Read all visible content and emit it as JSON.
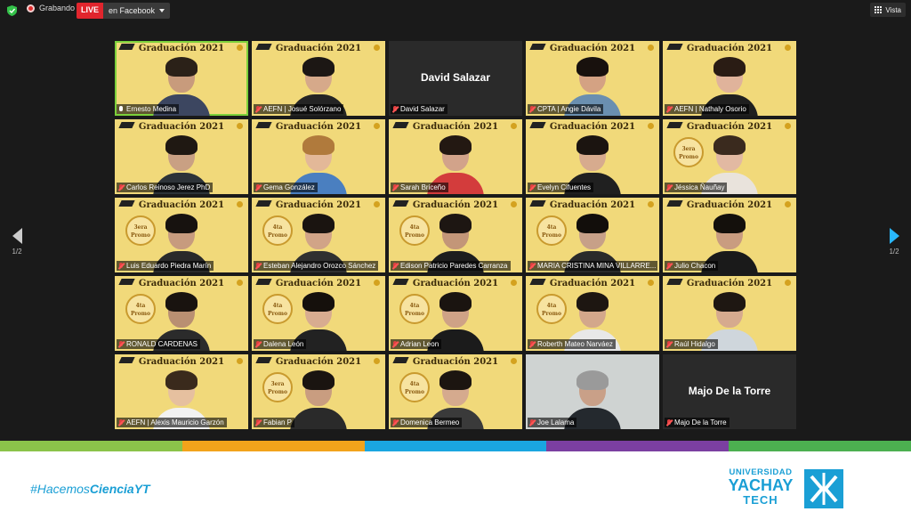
{
  "topbar": {
    "recording_label": "Grabando",
    "live_badge": "LIVE",
    "live_destination": "en Facebook",
    "view_label": "Vista"
  },
  "pagination": {
    "left": "1/2",
    "right": "1/2"
  },
  "participants": [
    {
      "name": "Ernesto Medina",
      "video": true,
      "mic": "on",
      "active": true,
      "crest": "",
      "skin": "#c89b7c",
      "hair": "#2b2118",
      "shirt": "#3c4660"
    },
    {
      "name": "AEFN | Josué Solórzano",
      "video": true,
      "mic": "muted",
      "crest": "",
      "skin": "#d6a98a",
      "hair": "#1c1714",
      "shirt": "#242424"
    },
    {
      "name": "David Salazar",
      "video": false,
      "mic": "muted",
      "display_name": "David Salazar"
    },
    {
      "name": "CPTA | Angie Dávila",
      "video": true,
      "mic": "muted",
      "crest": "",
      "skin": "#d4a283",
      "hair": "#18110d",
      "shirt": "#6a8fb0"
    },
    {
      "name": "AEFN | Nathaly Osorio",
      "video": true,
      "mic": "muted",
      "crest": "",
      "skin": "#e0b39b",
      "hair": "#2a1c14",
      "shirt": "#1f1f1f"
    },
    {
      "name": "Carlos Reinoso Jerez PhD",
      "video": true,
      "mic": "muted",
      "crest": "",
      "skin": "#c9a083",
      "hair": "#1f1812",
      "shirt": "#2d3338"
    },
    {
      "name": "Gema González",
      "video": true,
      "mic": "muted",
      "crest": "",
      "skin": "#e3b898",
      "hair": "#b07a3c",
      "shirt": "#4a7fc0"
    },
    {
      "name": "Sarah Briceño",
      "video": true,
      "mic": "muted",
      "crest": "",
      "skin": "#d2a38a",
      "hair": "#231812",
      "shirt": "#d33c3c"
    },
    {
      "name": "Evelyn Cifuentes",
      "video": true,
      "mic": "muted",
      "crest": "",
      "skin": "#d7ab8e",
      "hair": "#1b1410",
      "shirt": "#202020"
    },
    {
      "name": "Jéssica Ñauñay",
      "video": true,
      "mic": "muted",
      "crest": "3era Promo",
      "skin": "#e2b9a2",
      "hair": "#3a2a1e",
      "shirt": "#e9e3dc"
    },
    {
      "name": "Luis Eduardo Piedra Marín",
      "video": true,
      "mic": "muted",
      "crest": "3era Promo",
      "skin": "#c79b7e",
      "hair": "#17120f",
      "shirt": "#2a2a2a"
    },
    {
      "name": "Esteban Alejandro Orozco Sánchez",
      "video": true,
      "mic": "muted",
      "crest": "4ta Promo",
      "skin": "#d1a487",
      "hair": "#1a1410",
      "shirt": "#303030"
    },
    {
      "name": "Edison Patricio Paredes Carranza",
      "video": true,
      "mic": "muted",
      "crest": "4ta Promo",
      "skin": "#c39678",
      "hair": "#1d1612",
      "shirt": "#1e1e1e"
    },
    {
      "name": "MARIA CRISTINA MINA VILLARRE...",
      "video": true,
      "mic": "muted",
      "crest": "4ta Promo",
      "skin": "#c7a088",
      "hair": "#120e0b",
      "shirt": "#2a2a2a"
    },
    {
      "name": "Julio Chacon",
      "video": true,
      "mic": "muted",
      "crest": "",
      "skin": "#c99c80",
      "hair": "#14100c",
      "shirt": "#1a1a1a"
    },
    {
      "name": "RONALD CARDENAS",
      "video": true,
      "mic": "muted",
      "crest": "4ta Promo",
      "skin": "#b98f72",
      "hair": "#19130f",
      "shirt": "#2b2b2b"
    },
    {
      "name": "Dalena León",
      "video": true,
      "mic": "muted",
      "crest": "4ta Promo",
      "skin": "#d8ac90",
      "hair": "#15100c",
      "shirt": "#222222"
    },
    {
      "name": "Adrian Leon",
      "video": true,
      "mic": "muted",
      "crest": "4ta Promo",
      "skin": "#cfa286",
      "hair": "#1a1410",
      "shirt": "#1b1b1b"
    },
    {
      "name": "Roberth Mateo Narváez",
      "video": true,
      "mic": "muted",
      "crest": "4ta Promo",
      "skin": "#d3a78b",
      "hair": "#1d1611",
      "shirt": "#e8e8e8"
    },
    {
      "name": "Raúl Hidalgo",
      "video": true,
      "mic": "muted",
      "crest": "",
      "skin": "#d6aa8e",
      "hair": "#1e1712",
      "shirt": "#cfd6dc"
    },
    {
      "name": "AEFN | Alexis Mauricio Garzón",
      "video": true,
      "mic": "muted",
      "crest": "",
      "skin": "#e6c09f",
      "hair": "#3a2a1c",
      "shirt": "#f2f2f2"
    },
    {
      "name": "Fabian P",
      "video": true,
      "mic": "muted",
      "crest": "3era Promo",
      "skin": "#c99d80",
      "hair": "#1a1410",
      "shirt": "#2a2a2a"
    },
    {
      "name": "Domenica Bermeo",
      "video": true,
      "mic": "muted",
      "crest": "4ta Promo",
      "skin": "#d5aa8e",
      "hair": "#1c1510",
      "shirt": "#3a3a3a"
    },
    {
      "name": "Joe Lalama",
      "video": true,
      "mic": "muted",
      "crest": "",
      "skin": "#c9a088",
      "hair": "#9a9a9a",
      "shirt": "#24292e",
      "office": true
    },
    {
      "name": "Majo De la Torre",
      "video": false,
      "mic": "muted",
      "display_name": "Majo De la Torre"
    }
  ],
  "tile_banner": "Graduación 2021",
  "stripe_colors": [
    "#8bc34a",
    "#f2a31b",
    "#1aa6e0",
    "#7b3fa1",
    "#4caf50"
  ],
  "footer": {
    "hashtag_prefix": "#Hacemos",
    "hashtag_bold": "CienciaYT",
    "logo_line1": "UNIVERSIDAD",
    "logo_line2": "YACHAY",
    "logo_line3": "TECH"
  },
  "colors": {
    "tile_bg": "#f1d97a",
    "accent_blue": "#1a9fd5",
    "live_red": "#e1252d"
  }
}
